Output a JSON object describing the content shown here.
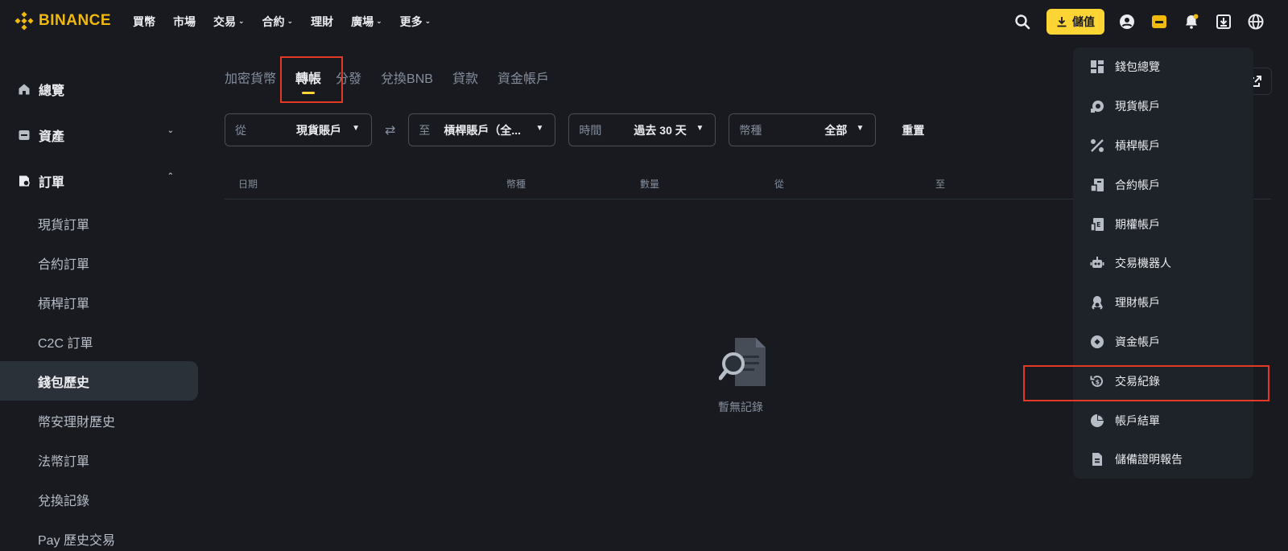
{
  "brand": {
    "name": "BINANCE",
    "color": "#f0b90b"
  },
  "nav": {
    "items": [
      {
        "label": "買幣",
        "dropdown": false
      },
      {
        "label": "市場",
        "dropdown": false
      },
      {
        "label": "交易",
        "dropdown": true
      },
      {
        "label": "合約",
        "dropdown": true
      },
      {
        "label": "理財",
        "dropdown": false
      },
      {
        "label": "廣場",
        "dropdown": true
      },
      {
        "label": "更多",
        "dropdown": true
      }
    ],
    "deposit_label": "儲值",
    "icons": [
      "search-icon",
      "user-icon",
      "wallet-icon",
      "bell-icon",
      "download-icon",
      "globe-icon"
    ]
  },
  "sidebar": {
    "sections": [
      {
        "label": "總覽",
        "icon": "home-icon"
      },
      {
        "label": "資產",
        "icon": "assets-icon"
      },
      {
        "label": "訂單",
        "icon": "orders-icon"
      }
    ],
    "order_items": [
      "現貨訂單",
      "合約訂單",
      "槓桿訂單",
      "C2C 訂單",
      "錢包歷史",
      "幣安理財歷史",
      "法幣訂單",
      "兌換記錄",
      "Pay 歷史交易"
    ],
    "active": "錢包歷史"
  },
  "tabs": {
    "items": [
      "加密貨幣",
      "轉帳",
      "分發",
      "兌換BNB",
      "貸款",
      "資金帳戶"
    ],
    "active": "轉帳"
  },
  "filters": {
    "from": {
      "label": "從",
      "value": "現貨賬戶"
    },
    "to": {
      "label": "至",
      "value": "槓桿賬戶（全..."
    },
    "time": {
      "label": "時間",
      "value": "過去 30 天"
    },
    "coin": {
      "label": "幣種",
      "value": "全部"
    },
    "reset_label": "重置"
  },
  "table": {
    "columns": [
      "日期",
      "幣種",
      "數量",
      "從",
      "至"
    ]
  },
  "empty_state": {
    "text": "暫無記錄"
  },
  "wallet_menu": {
    "items": [
      {
        "label": "錢包總覽",
        "icon": "wallet-overview-icon"
      },
      {
        "label": "現貨帳戶",
        "icon": "spot-icon"
      },
      {
        "label": "槓桿帳戶",
        "icon": "margin-icon"
      },
      {
        "label": "合約帳戶",
        "icon": "futures-icon"
      },
      {
        "label": "期權帳戶",
        "icon": "options-icon"
      },
      {
        "label": "交易機器人",
        "icon": "robot-icon"
      },
      {
        "label": "理財帳戶",
        "icon": "earn-icon"
      },
      {
        "label": "資金帳戶",
        "icon": "funding-icon"
      },
      {
        "label": "交易紀錄",
        "icon": "transaction-history-icon"
      },
      {
        "label": "帳戶結單",
        "icon": "statement-icon"
      },
      {
        "label": "儲備證明報告",
        "icon": "report-icon"
      }
    ]
  },
  "colors": {
    "accent": "#fcd535",
    "highlight": "#e33a26",
    "bg": "#181a20",
    "panel": "#1e2329"
  }
}
